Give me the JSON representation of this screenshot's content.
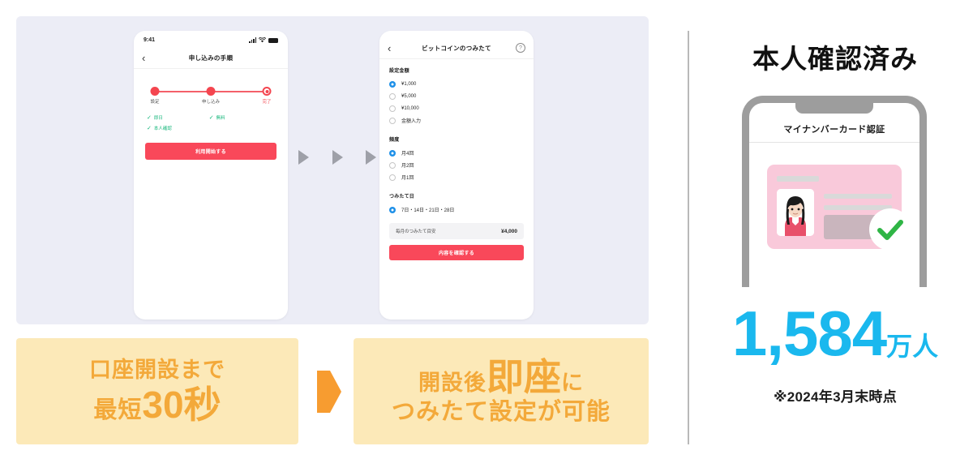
{
  "phone_one": {
    "status_time": "9:41",
    "nav_title": "申し込みの手順",
    "back_icon": "‹",
    "steps": [
      {
        "label": "設定"
      },
      {
        "label": "申し込み"
      },
      {
        "label": "完了"
      }
    ],
    "checks": [
      {
        "label": "即日"
      },
      {
        "label": "無料"
      },
      {
        "label": "本人確認"
      }
    ],
    "cta_label": "利用開始する"
  },
  "phone_two": {
    "nav_title": "ビットコインのつみたて",
    "back_icon": "‹",
    "help_icon": "?",
    "amount_section": {
      "title": "設定金額",
      "options": [
        {
          "label": "¥1,000",
          "selected": true
        },
        {
          "label": "¥5,000",
          "selected": false
        },
        {
          "label": "¥10,000",
          "selected": false
        },
        {
          "label": "金額入力",
          "selected": false
        }
      ]
    },
    "frequency_section": {
      "title": "頻度",
      "options": [
        {
          "label": "月4回",
          "selected": true
        },
        {
          "label": "月2回",
          "selected": false
        },
        {
          "label": "月1回",
          "selected": false
        }
      ]
    },
    "day_section": {
      "title": "つみたて日",
      "options": [
        {
          "label": "7日・14日・21日・28日",
          "selected": true
        }
      ]
    },
    "summary": {
      "label": "毎月のつみたて目安",
      "value": "¥4,000"
    },
    "cta_label": "内容を確認する"
  },
  "callouts": {
    "left": {
      "line1": "口座開設まで",
      "line2_small": "最短",
      "line2_large": "30秒"
    },
    "right": {
      "line1_small_a": "開設後",
      "line1_large": "即座",
      "line1_small_b": "に",
      "line2": "つみたて設定が可能"
    }
  },
  "right_panel": {
    "heading": "本人確認済み",
    "phone_screen_title": "マイナンバーカード認証",
    "stat_value": "1,584",
    "stat_unit": "万人",
    "stat_note": "※2024年3月末時点"
  },
  "colors": {
    "panel_bg": "#ecedf6",
    "accent_red": "#f9485a",
    "accent_blue": "#1e90e8",
    "callout_bg": "#fce9b8",
    "callout_text": "#f3a93a",
    "stat_cyan": "#1ab8ee",
    "check_green": "#14b67a"
  }
}
